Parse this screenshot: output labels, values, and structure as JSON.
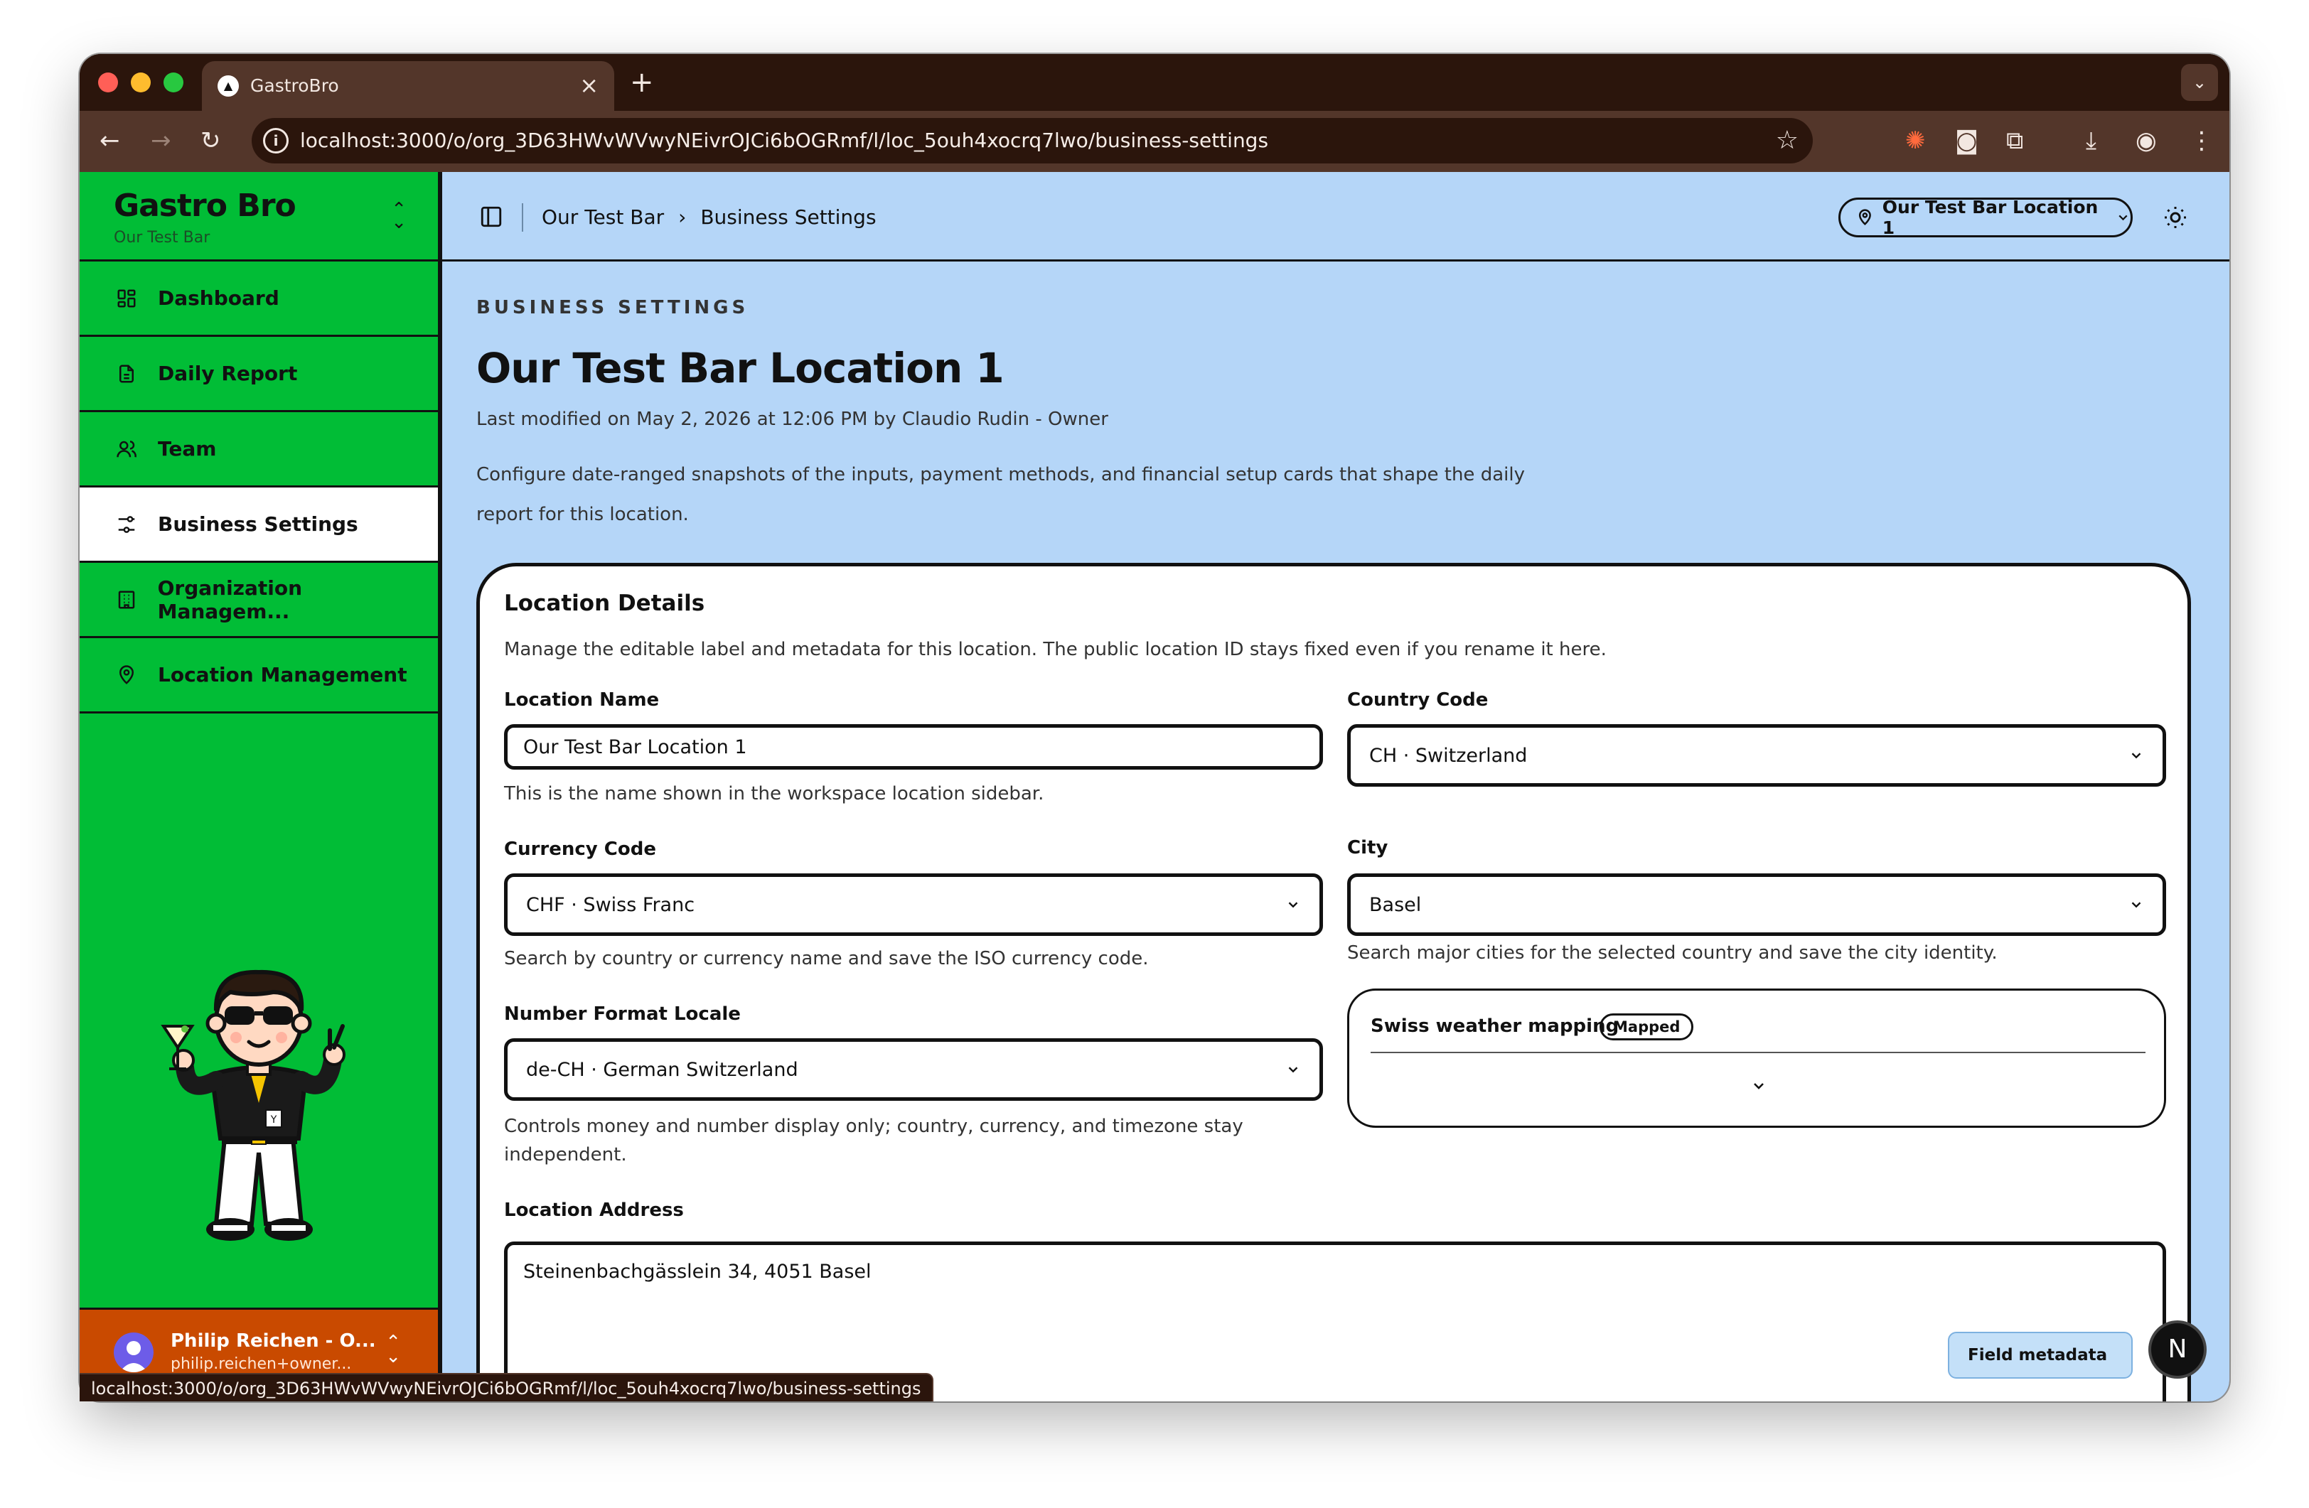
{
  "browser": {
    "tab_title": "GastroBro",
    "tab_close": "×",
    "new_tab": "+",
    "url": "localhost:3000/o/org_3D63HWvWVwyNEivrOJCi6bOGRmf/l/loc_5ouh4xocrq7lwo/business-settings",
    "status_url": "localhost:3000/o/org_3D63HWvWVwyNEivrOJCi6bOGRmf/l/loc_5ouh4xocrq7lwo/business-settings"
  },
  "sidebar": {
    "brand": "Gastro Bro",
    "org": "Our Test Bar",
    "items": [
      {
        "label": "Dashboard",
        "icon": "grid-icon"
      },
      {
        "label": "Daily Report",
        "icon": "document-icon"
      },
      {
        "label": "Team",
        "icon": "users-icon"
      },
      {
        "label": "Business Settings",
        "icon": "sliders-icon",
        "active": true
      },
      {
        "label": "Organization Managem...",
        "icon": "building-icon"
      },
      {
        "label": "Location Management",
        "icon": "map-pin-icon"
      }
    ],
    "user": {
      "name": "Philip Reichen - O...",
      "email": "philip.reichen+owner..."
    }
  },
  "topbar": {
    "crumbs": [
      "Our Test Bar",
      "Business Settings"
    ],
    "location_selector": "Our Test Bar Location 1"
  },
  "page": {
    "eyebrow": "BUSINESS SETTINGS",
    "title": "Our Test Bar Location 1",
    "modified": "Last modified on May 2, 2026 at 12:06 PM by Claudio Rudin - Owner",
    "description": "Configure date-ranged snapshots of the inputs, payment methods, and financial setup cards that shape the daily report for this location."
  },
  "card": {
    "title": "Location Details",
    "subtitle": "Manage the editable label and metadata for this location. The public location ID stays fixed even if you rename it here.",
    "location_name": {
      "label": "Location Name",
      "value": "Our Test Bar Location 1",
      "help": "This is the name shown in the workspace location sidebar."
    },
    "country_code": {
      "label": "Country Code",
      "value": "CH · Switzerland"
    },
    "currency_code": {
      "label": "Currency Code",
      "value": "CHF · Swiss Franc",
      "help": "Search by country or currency name and save the ISO currency code."
    },
    "city": {
      "label": "City",
      "value": "Basel",
      "help": "Search major cities for the selected country and save the city identity."
    },
    "number_format": {
      "label": "Number Format Locale",
      "value": "de-CH · German Switzerland",
      "help": "Controls money and number display only; country, currency, and timezone stay independent."
    },
    "weather": {
      "title": "Swiss weather mapping",
      "badge": "Mapped"
    },
    "address": {
      "label": "Location Address",
      "value": "Steinenbachgässlein 34, 4051 Basel"
    }
  },
  "overlay": {
    "field_metadata": "Field metadata",
    "next_badge": "N"
  },
  "colors": {
    "sidebar_green": "#01bd36",
    "main_blue": "#b5d6f8",
    "user_orange": "#c94a00",
    "browser_chrome": "#2b150c"
  }
}
